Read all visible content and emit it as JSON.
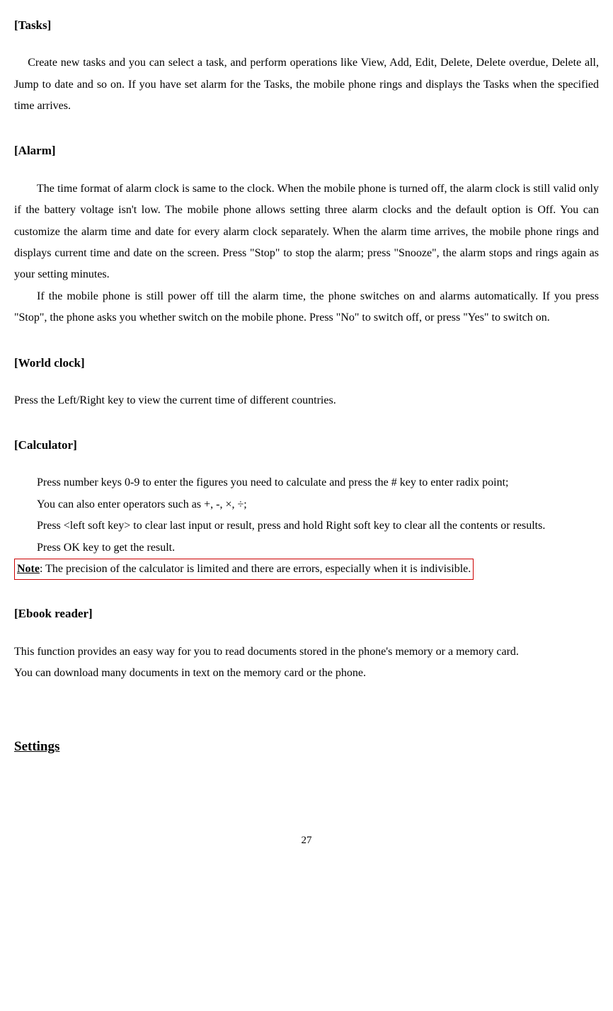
{
  "sections": {
    "tasks": {
      "heading": "[Tasks]",
      "p1": "Create new tasks and you can select a task, and perform operations like View, Add, Edit, Delete, Delete overdue, Delete all, Jump to date and so on. If you have set alarm for the Tasks, the mobile phone rings and displays the Tasks when the specified time arrives."
    },
    "alarm": {
      "heading": "[Alarm]",
      "p1": "The time format of alarm clock is same to the clock. When the mobile phone is turned off, the alarm clock is still valid only if the battery voltage isn't low. The mobile phone allows setting three alarm clocks and the default option is Off. You can customize the alarm time and date for every alarm clock separately. When the alarm time arrives, the mobile phone rings and displays current time and date on the screen. Press \"Stop\" to stop the alarm; press \"Snooze\", the alarm stops and rings again as your setting minutes.",
      "p2": "If the mobile phone is still power off till the alarm time, the phone switches on and alarms automatically. If you press \"Stop\", the phone asks you whether switch on the mobile phone. Press \"No\" to switch off, or press \"Yes\" to switch on."
    },
    "worldclock": {
      "heading": "[World clock]",
      "p1": "Press the Left/Right key to view the current time of different countries."
    },
    "calculator": {
      "heading": "[Calculator]",
      "p1": "Press number keys 0-9 to enter the figures you need to calculate and press the # key to enter radix point;",
      "p2": "You can also enter operators such as +, -, ×, ÷;",
      "p3": "Press <left soft key> to clear last input or result, press and hold Right soft key to clear all the contents or results.",
      "p4": "Press OK key to get the result.",
      "note_label": "Note",
      "note_text": ": The precision of the calculator is limited and there are errors, especially when it is indivisible."
    },
    "ebook": {
      "heading": "[Ebook reader]",
      "p1": "This function provides an easy way for you to read documents stored in the phone's memory or a memory card.",
      "p2": "You can download many documents in text on the memory card or the phone."
    },
    "settings": {
      "heading": "Settings"
    }
  },
  "page_number": "27"
}
